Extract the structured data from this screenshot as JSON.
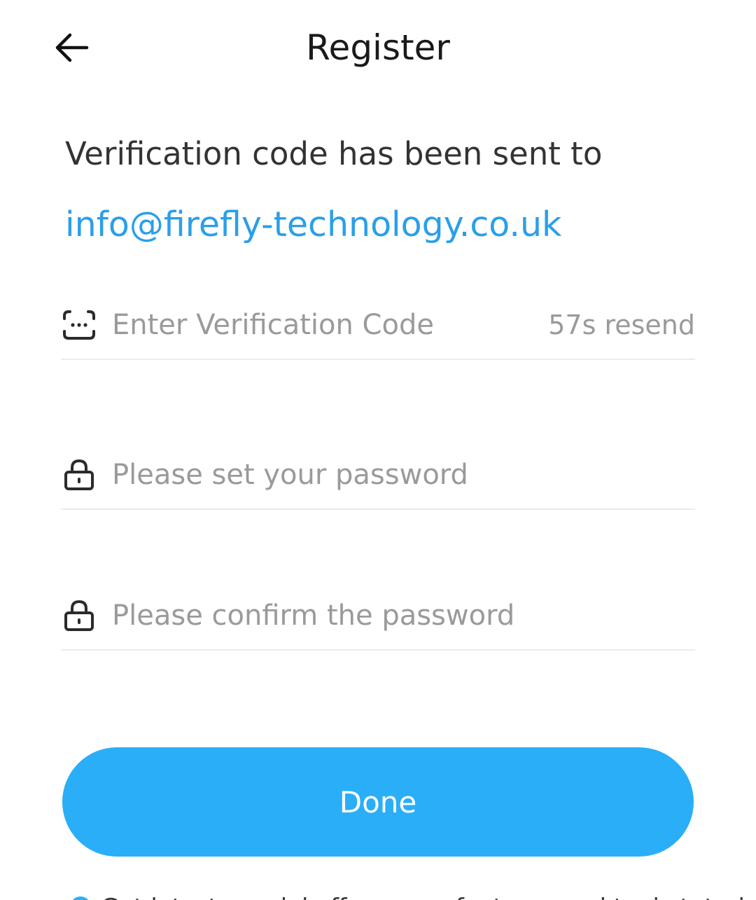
{
  "colors": {
    "accent": "#2aaef8",
    "link": "#2a9fe8",
    "text_primary": "#1a1a1a",
    "placeholder": "#9a9a9a",
    "divider": "#ebebeb"
  },
  "header": {
    "title": "Register",
    "back_icon": "arrow-left-icon"
  },
  "info": {
    "message": "Verification code has been sent to",
    "email": "info@firefly-technology.co.uk"
  },
  "fields": {
    "verification": {
      "icon": "keypad-icon",
      "placeholder": "Enter Verification Code",
      "value": "",
      "resend_label": "57s resend"
    },
    "password": {
      "icon": "lock-icon",
      "placeholder": "Please set your password",
      "value": ""
    },
    "confirm_password": {
      "icon": "lock-icon",
      "placeholder": "Please confirm the password",
      "value": ""
    }
  },
  "actions": {
    "done_label": "Done"
  },
  "footer": {
    "checkbox_icon": "radio-dot-icon",
    "text": "Get latest special offers, new features and topic tutorials"
  }
}
